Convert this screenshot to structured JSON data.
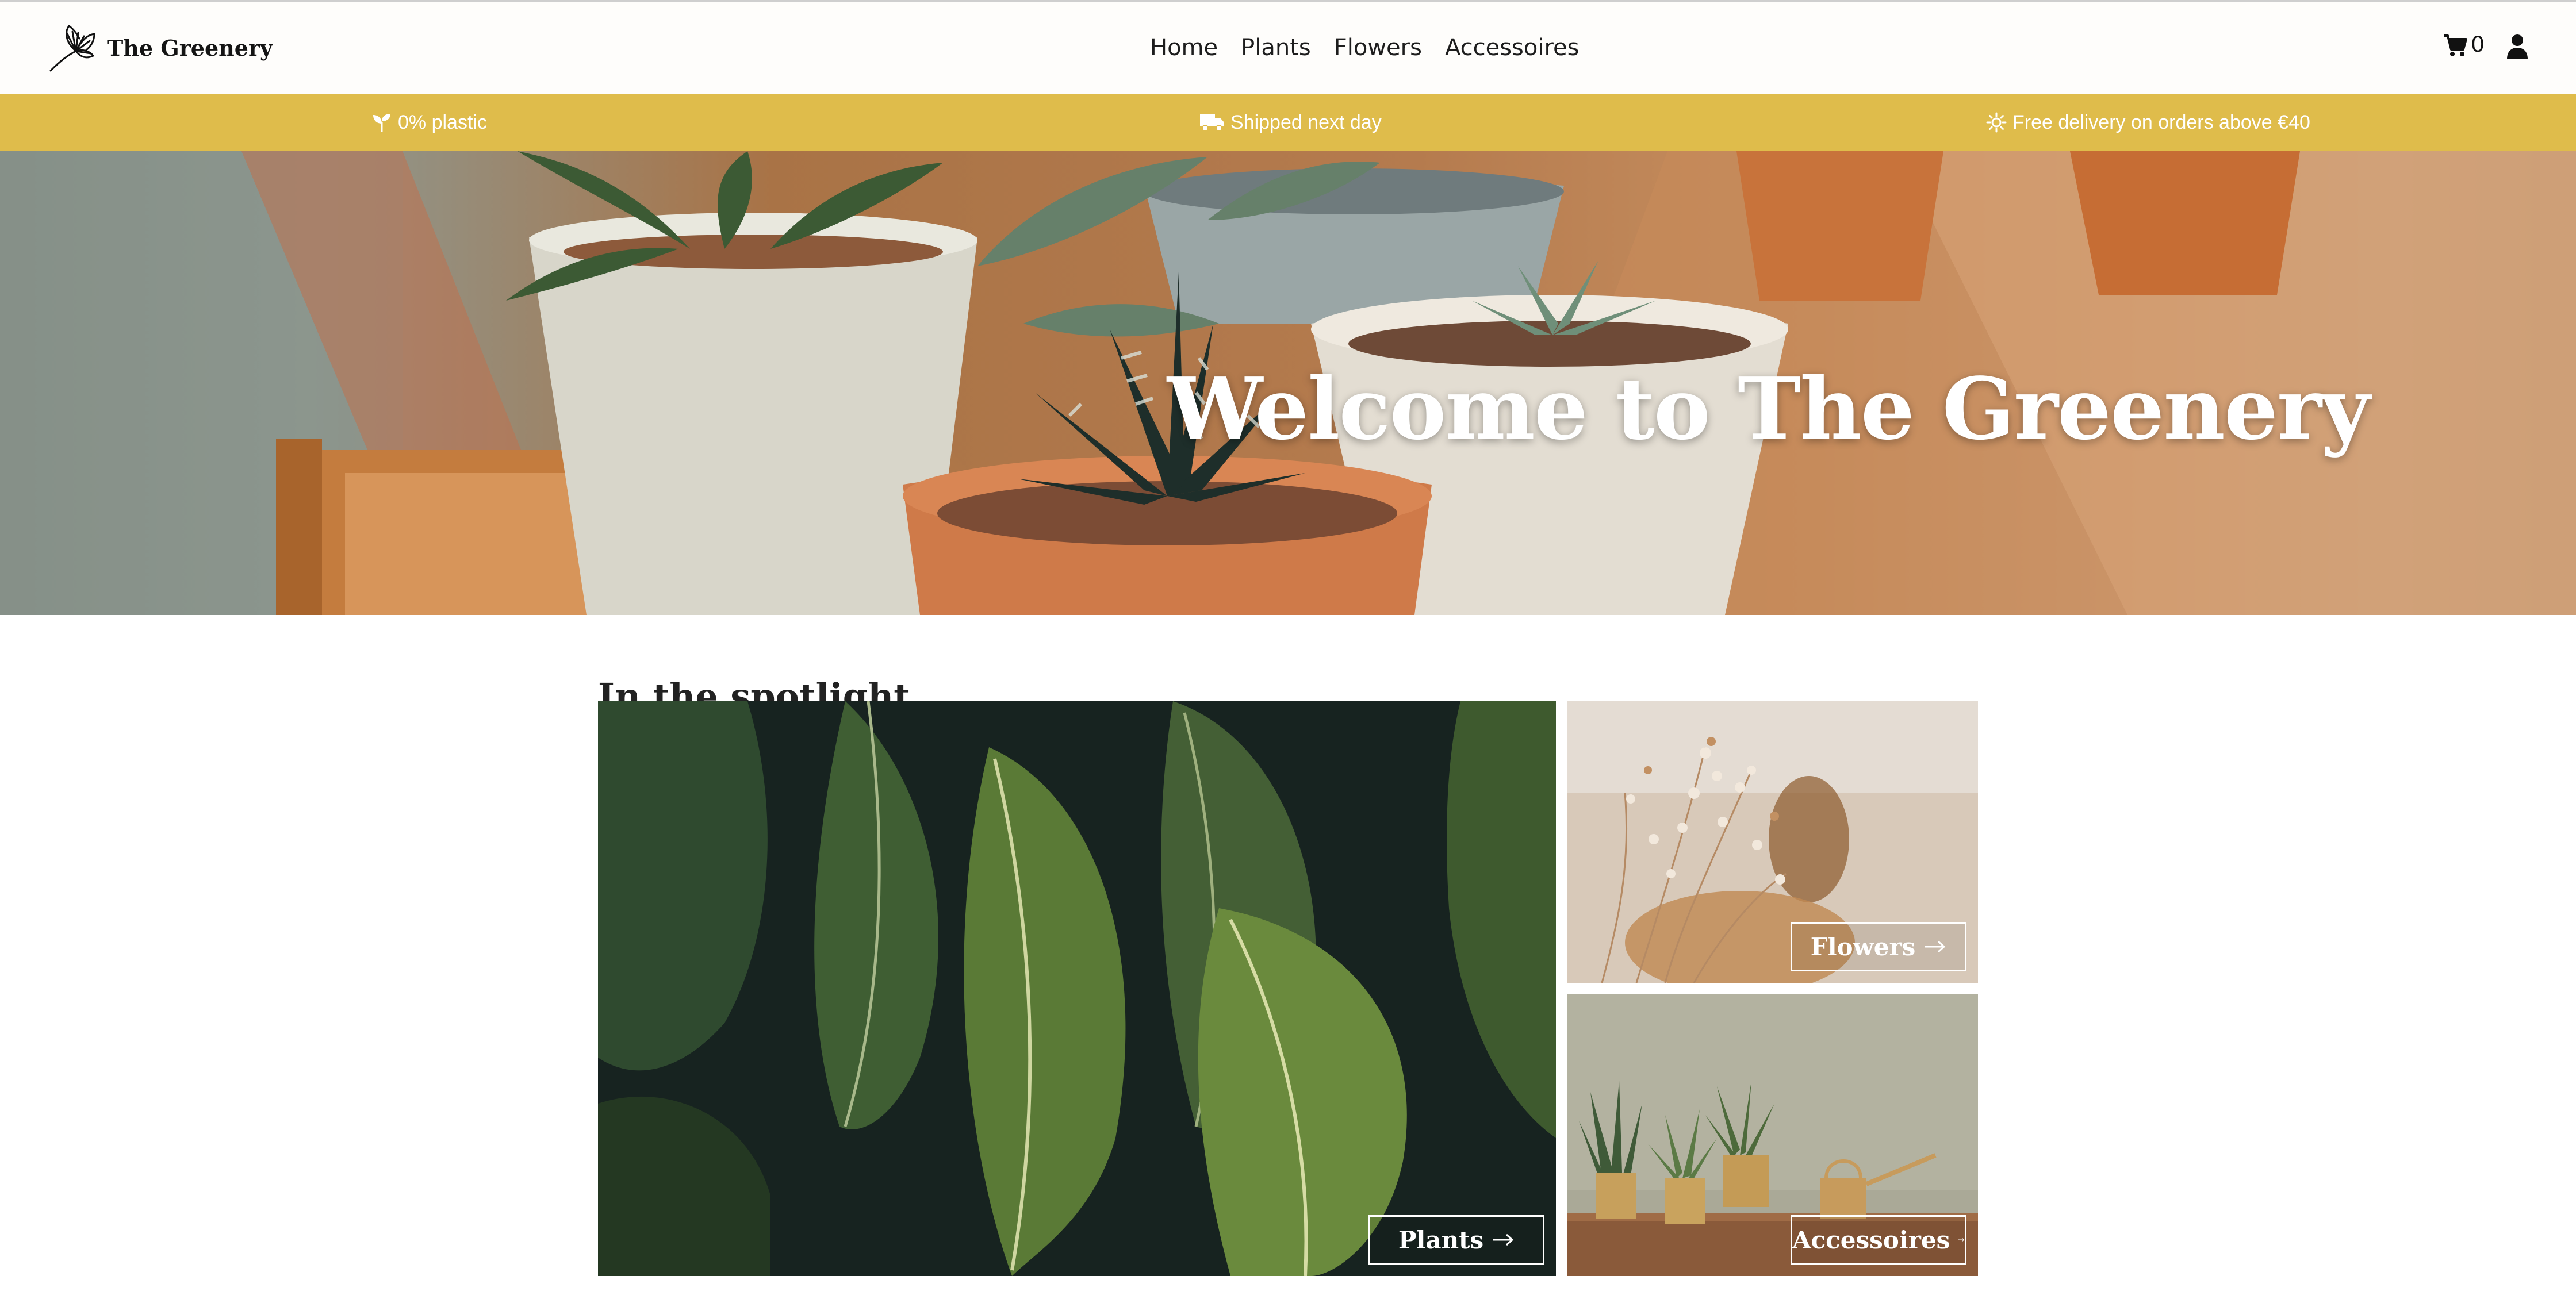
{
  "brand": {
    "name": "The Greenery",
    "logo_icon": "ginkgo-leaf-icon"
  },
  "nav": {
    "items": [
      "Home",
      "Plants",
      "Flowers",
      "Accessoires"
    ]
  },
  "cart": {
    "icon": "cart-icon",
    "count": "0"
  },
  "user": {
    "icon": "user-icon"
  },
  "infobar": {
    "color": "#dfbc4b",
    "items": [
      {
        "icon": "seedling-icon",
        "text": "0% plastic"
      },
      {
        "icon": "truck-icon",
        "text": "Shipped next day"
      },
      {
        "icon": "sun-icon",
        "text": "Free delivery on orders above €40"
      }
    ]
  },
  "hero": {
    "title": "Welcome to The Greenery"
  },
  "spotlight": {
    "title": "In the spotlight",
    "cards": [
      {
        "label": "Plants",
        "arrow_icon": "arrow-right-icon"
      },
      {
        "label": "Flowers",
        "arrow_icon": "arrow-right-icon"
      },
      {
        "label": "Accessoires",
        "arrow_icon": "arrow-right-icon"
      }
    ]
  }
}
